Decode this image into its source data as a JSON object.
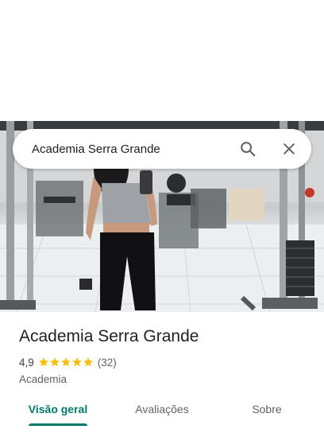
{
  "search": {
    "query": "Academia Serra Grande"
  },
  "place": {
    "name": "Academia Serra Grande",
    "rating": "4,9",
    "stars": 5,
    "reviews": "(32)",
    "category": "Academia"
  },
  "tabs": [
    {
      "label": "Visão geral",
      "active": true
    },
    {
      "label": "Avaliações",
      "active": false
    },
    {
      "label": "Sobre",
      "active": false
    }
  ],
  "colors": {
    "accent": "#00796b",
    "star": "#fbbc04",
    "text_primary": "#202124",
    "text_secondary": "#5f6368"
  },
  "icons": {
    "search": "search-icon",
    "close": "close-icon",
    "star": "star-icon"
  }
}
